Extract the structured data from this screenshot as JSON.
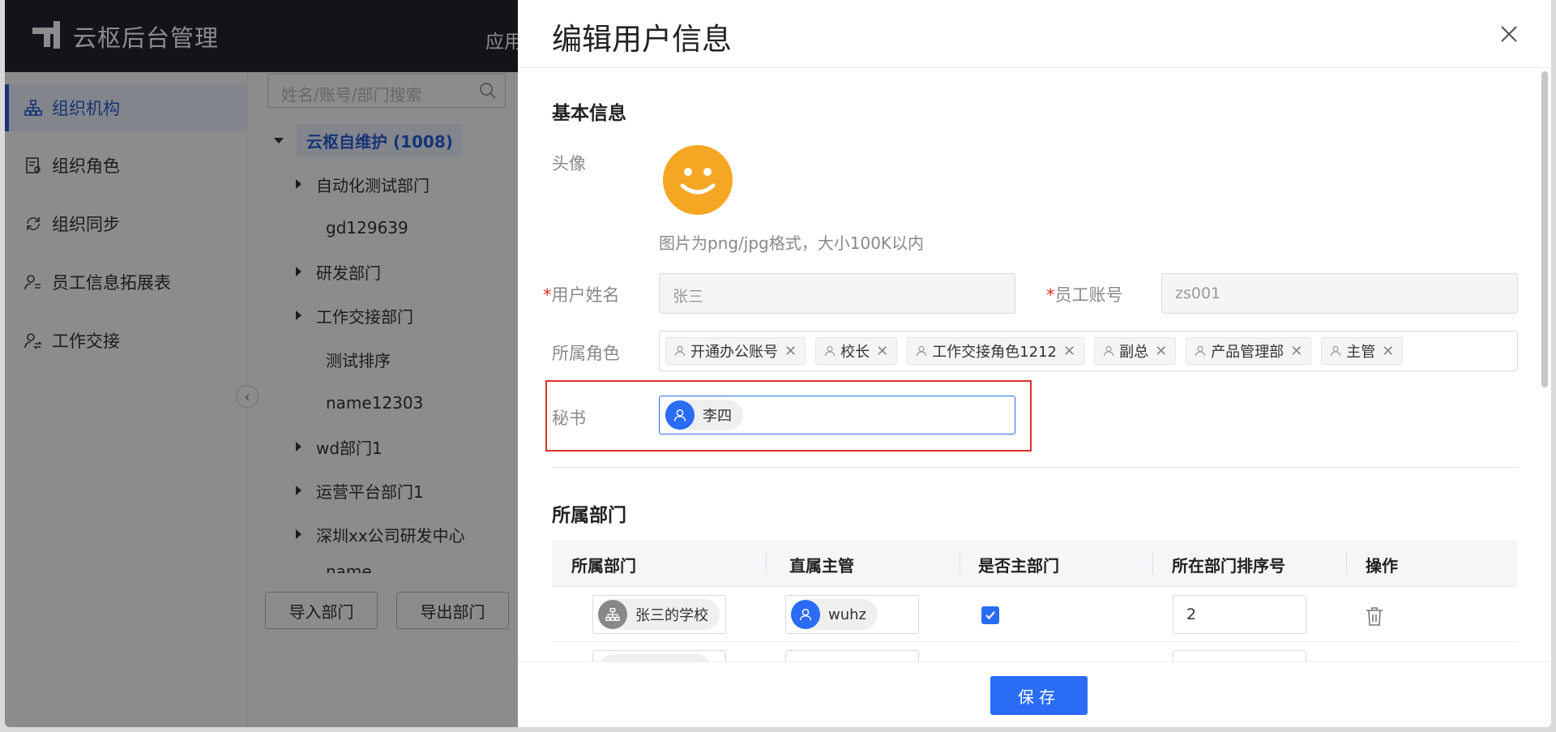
{
  "header": {
    "app_title": "云枢后台管理",
    "nav_cut": "应用"
  },
  "sidebar": {
    "items": [
      {
        "label": "组织机构",
        "active": true
      },
      {
        "label": "组织角色"
      },
      {
        "label": "组织同步"
      },
      {
        "label": "员工信息拓展表"
      },
      {
        "label": "工作交接"
      }
    ]
  },
  "tree": {
    "search_placeholder": "姓名/账号/部门搜索",
    "root": "云枢自维护 (1008)",
    "nodes": [
      "自动化测试部门",
      "gd129639",
      "研发部门",
      "工作交接部门",
      "测试排序",
      "name12303",
      "wd部门1",
      "运营平台部门1",
      "深圳xx公司研发中心",
      "name"
    ],
    "import_label": "导入部门",
    "export_label": "导出部门"
  },
  "drawer": {
    "title": "编辑用户信息",
    "basic_title": "基本信息",
    "avatar_label": "头像",
    "avatar_hint": "图片为png/jpg格式，大小100K以内",
    "name_label": "用户姓名",
    "name_value": "张三",
    "account_label": "员工账号",
    "account_value": "zs001",
    "role_label": "所属角色",
    "roles": [
      "开通办公账号",
      "校长",
      "工作交接角色1212",
      "副总",
      "产品管理部",
      "主管"
    ],
    "secretary_label": "秘书",
    "secretary_value": "李四",
    "dept_title": "所属部门",
    "table_headers": [
      "所属部门",
      "直属主管",
      "是否主部门",
      "所在部门排序号",
      "操作"
    ],
    "rows": [
      {
        "dept": "张三的学校",
        "manager": "wuhz",
        "is_main": true,
        "order": "2"
      }
    ],
    "save_label": "保存"
  },
  "colors": {
    "primary": "#2a6cf6",
    "header_bg": "#23262e",
    "highlight": "#e02d2d",
    "avatar": "#f5a623"
  }
}
